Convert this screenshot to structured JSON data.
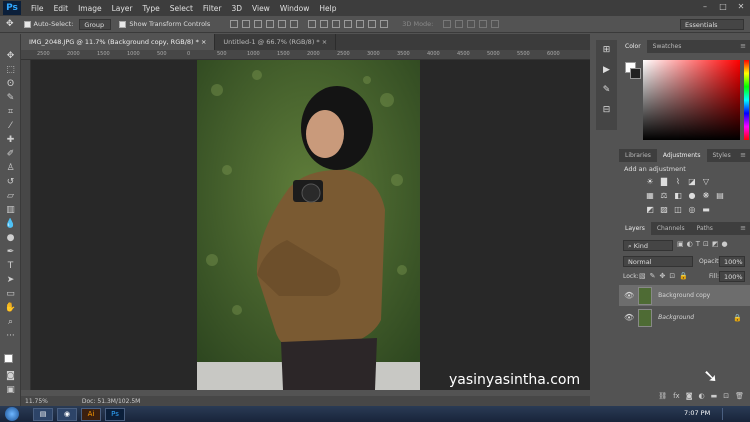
{
  "app": {
    "logo": "Ps"
  },
  "menu": [
    "File",
    "Edit",
    "Image",
    "Layer",
    "Type",
    "Select",
    "Filter",
    "3D",
    "View",
    "Window",
    "Help"
  ],
  "window_controls": [
    "–",
    "□",
    "✕"
  ],
  "options": {
    "auto_select_label": "Auto-Select:",
    "auto_select_value": "Group",
    "transform_label": "Show Transform Controls",
    "mode_3d": "3D Mode:",
    "workspace": "Essentials"
  },
  "tabs": [
    {
      "label": "IMG_2048.JPG @ 11.7% (Background copy, RGB/8) *"
    },
    {
      "label": "Untitled-1 @ 66.7% (RGB/8) *"
    }
  ],
  "ruler_ticks": [
    "2500",
    "2000",
    "1500",
    "1000",
    "500",
    "0",
    "500",
    "1000",
    "1500",
    "2000",
    "2500",
    "3000",
    "3500",
    "4000",
    "4500",
    "5000",
    "5500",
    "6000"
  ],
  "status": {
    "zoom": "11.75%",
    "doc": "Doc: 51.3M/102.5M"
  },
  "watermark": "yasinyasintha.com",
  "panels": {
    "color_tabs": [
      "Color",
      "Swatches"
    ],
    "adjust_tabs": [
      "Libraries",
      "Adjustments",
      "Styles"
    ],
    "add_adjustment": "Add an adjustment",
    "layer_tabs": [
      "Layers",
      "Channels",
      "Paths"
    ],
    "kind": "Kind",
    "blend_mode": "Normal",
    "opacity_label": "Opacity:",
    "opacity_value": "100%",
    "lock_label": "Lock:",
    "fill_label": "Fill:",
    "fill_value": "100%"
  },
  "layers": [
    {
      "name": "Background copy",
      "selected": true
    },
    {
      "name": "Background",
      "selected": false
    }
  ],
  "taskbar": {
    "time": "7:07 PM"
  },
  "colors": {
    "accent": "#31a8ff",
    "selected_layer": "#6d6d6d"
  }
}
